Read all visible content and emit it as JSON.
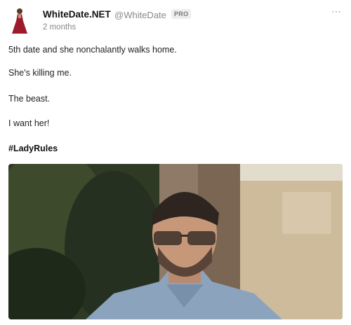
{
  "post": {
    "author_name": "WhiteDate.NET",
    "handle": "@WhiteDate",
    "badge": "PRO",
    "timestamp": "2 months",
    "more_icon": "⋯",
    "lines": [
      "5th date and she nonchalantly walks home.",
      "She's killing me.",
      "The beast.",
      "I want her!"
    ],
    "hashtag": "#LadyRules"
  },
  "icons": {
    "avatar": "woman-red-dress-avatar",
    "more": "more-options-icon"
  },
  "colors": {
    "avatar_dress": "#9b1b2c",
    "muted_text": "#888888",
    "badge_bg": "#eeeeee"
  }
}
